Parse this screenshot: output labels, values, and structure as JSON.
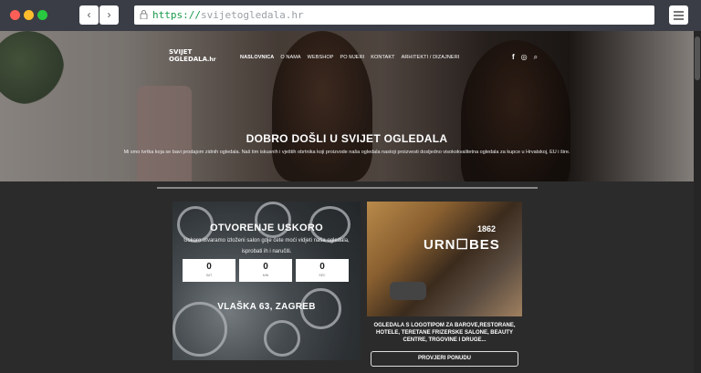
{
  "browser": {
    "url_scheme": "https://",
    "url_host": "svijetogledala.hr",
    "back_icon": "chevron-left-icon",
    "forward_icon": "chevron-right-icon",
    "menu_icon": "sliders-icon"
  },
  "header": {
    "logo_line1": "SVIJET",
    "logo_line2": "OGLEDALA",
    "logo_suffix": ".hr",
    "nav": [
      {
        "label": "NASLOVNICA"
      },
      {
        "label": "O NAMA"
      },
      {
        "label": "WEBSHOP"
      },
      {
        "label": "PO MJERI"
      },
      {
        "label": "KONTAKT"
      },
      {
        "label": "ARHITEKTI / DIZAJNERI"
      }
    ],
    "social_facebook": "f",
    "social_instagram": "◎",
    "search_glyph": "⌕"
  },
  "hero": {
    "title": "DOBRO DOŠLI U SVIJET OGLEDALA",
    "subtitle": "Mi smo tvrtka koja se bavi prodajom zidnih ogledala. Naš tim iskusnih i vještih obrtnika koji proizvode naša ogledala nastoji proizvesti dosljedno visokokvalitetna ogledala za kupce u Hrvatskoj, EU i šire."
  },
  "card_left": {
    "title": "OTVORENJE USKORO",
    "text": "Uskoro otvaramo izloženi salon gdje ćete moći vidjeti naša ogledala, isprobati ih i naručiti.",
    "countdown": [
      {
        "value": "0",
        "unit": "SAT"
      },
      {
        "value": "0",
        "unit": "MIN"
      },
      {
        "value": "0",
        "unit": "SEC"
      }
    ],
    "address": "VLAŠKA 63, ZAGREB"
  },
  "card_right": {
    "image_sign": "URN☐BES",
    "image_year": "1862",
    "text": "OGLEDALA S LOGOTIPOM ZA BAROVE,RESTORANE, HOTELE, TERETANE FRIZERSKE SALONE, BEAUTY CENTRE, TRGOVINE I DRUGE...",
    "button_label": "PROVJERI PONUDU"
  }
}
